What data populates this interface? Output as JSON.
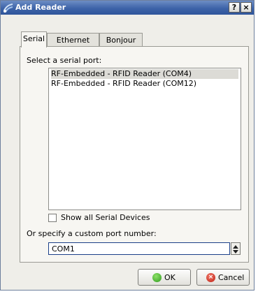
{
  "window": {
    "title": "Add Reader",
    "help_label": "?",
    "close_label": "×"
  },
  "tabs": [
    {
      "label": "Serial",
      "active": true
    },
    {
      "label": "Ethernet",
      "active": false
    },
    {
      "label": "Bonjour",
      "active": false
    }
  ],
  "serial": {
    "select_label": "Select a serial port:",
    "ports": [
      {
        "label": "RF-Embedded - RFID Reader (COM4)",
        "selected": true
      },
      {
        "label": "RF-Embedded - RFID Reader (COM12)",
        "selected": false
      }
    ],
    "show_all_label": "Show all Serial Devices",
    "show_all_checked": false,
    "custom_label": "Or specify a custom port number:",
    "custom_value": "COM1"
  },
  "buttons": {
    "ok_label": "OK",
    "cancel_label": "Cancel"
  },
  "icons": {
    "title": "reader-icon",
    "ok": "check-circle-icon",
    "cancel": "x-circle-icon"
  },
  "colors": {
    "titlebar": "#3d63a8",
    "dialog_bg": "#efeee9",
    "focus_border": "#1b3f88"
  }
}
